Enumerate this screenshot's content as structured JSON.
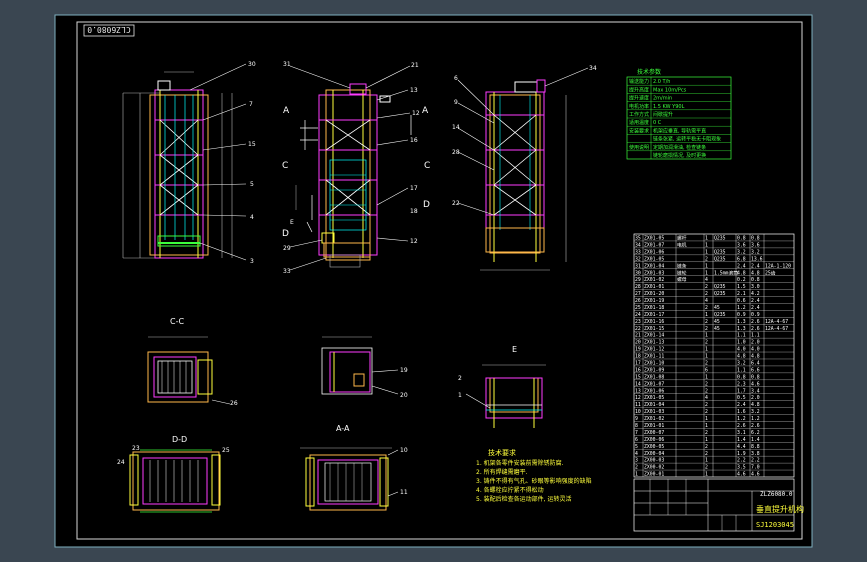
{
  "drawing": {
    "code_box": "CLZ6080.0",
    "view_labels": {
      "cc": "C-C",
      "dd": "D-D",
      "aa": "A-A",
      "detail": "E"
    },
    "section_marks": [
      "A",
      "A",
      "C",
      "C",
      "D",
      "D",
      "E"
    ],
    "callouts": [
      "30",
      "7",
      "15",
      "5",
      "4",
      "3",
      "31",
      "21",
      "13",
      "12",
      "16",
      "17",
      "18",
      "12",
      "29",
      "33",
      "6",
      "9",
      "14",
      "28",
      "22",
      "34",
      "19",
      "20",
      "2",
      "1",
      "26",
      "23",
      "24",
      "25",
      "10",
      "11"
    ],
    "tech_title": "技术要求",
    "tech_notes": [
      "1. 机架各零件安装前需除锈防腐.",
      "2. 所有焊缝需磨平.",
      "3. 铸件不得有气孔、砂眼等影响强度的缺陷",
      "4. 各螺栓应拧紧不得松动",
      "5. 装配后检查各运动部件, 运转灵活"
    ],
    "param_title": "技术参数",
    "params": [
      [
        "输送能力",
        "2.0 T/h"
      ],
      [
        "提升高度",
        "Max 10m/Pcs"
      ],
      [
        "提升速度",
        "2m/min"
      ],
      [
        "电机功率",
        "1.5 KW Y90L"
      ],
      [
        "工作方式",
        "间歇提升"
      ],
      [
        "适用温度",
        "0 C"
      ],
      [
        "安装要求",
        "机架应垂直, 导轨需平直"
      ],
      [
        "",
        "链条张紧, 运转平稳无卡阻现象"
      ],
      [
        "使用说明",
        "定期加润滑油, 检查链条"
      ],
      [
        "",
        "链轮磨损情况, 及时更换"
      ]
    ],
    "bom": [
      [
        "35",
        "ZX01-05",
        "螺杆",
        "1",
        "Q235",
        "0.8",
        "0.8",
        ""
      ],
      [
        "34",
        "ZX01-07",
        "电机",
        "1",
        "",
        "3.6",
        "3.6",
        ""
      ],
      [
        "33",
        "ZX01-06",
        "",
        "1",
        "Q235",
        "3.2",
        "3.2",
        ""
      ],
      [
        "32",
        "ZX01-05",
        "",
        "2",
        "Q235",
        "6.8",
        "13.6",
        ""
      ],
      [
        "31",
        "ZX01-04",
        "链条",
        "1",
        "",
        "2.4",
        "2.4",
        "12A-1-120"
      ],
      [
        "30",
        "ZX01-03",
        "链轮",
        "1",
        "1.5mm滚筒",
        "4.8",
        "4.8",
        "25齿"
      ],
      [
        "29",
        "ZX01-02",
        "螺母",
        "4",
        "",
        "0.2",
        "0.8",
        ""
      ],
      [
        "28",
        "ZX01-01",
        "",
        "2",
        "Q235",
        "1.5",
        "3.0",
        ""
      ],
      [
        "27",
        "ZX01-20",
        "",
        "2",
        "Q235",
        "2.1",
        "4.2",
        ""
      ],
      [
        "26",
        "ZX01-19",
        "",
        "4",
        "",
        "0.6",
        "2.4",
        ""
      ],
      [
        "25",
        "ZX01-18",
        "",
        "2",
        "45",
        "1.2",
        "2.4",
        ""
      ],
      [
        "24",
        "ZX01-17",
        "",
        "1",
        "Q235",
        "0.9",
        "0.9",
        ""
      ],
      [
        "23",
        "ZX01-16",
        "",
        "2",
        "45",
        "1.3",
        "2.6",
        "12A-4-67"
      ],
      [
        "22",
        "ZX01-15",
        "",
        "2",
        "45",
        "1.3",
        "2.6",
        "12A-4-67"
      ],
      [
        "21",
        "ZX01-14",
        "",
        "1",
        "",
        "1.1",
        "1.1",
        ""
      ],
      [
        "20",
        "ZX01-13",
        "",
        "2",
        "",
        "1.0",
        "2.0",
        ""
      ],
      [
        "19",
        "ZX01-12",
        "",
        "1",
        "",
        "4.0",
        "4.0",
        ""
      ],
      [
        "18",
        "ZX01-11",
        "",
        "1",
        "",
        "4.8",
        "4.8",
        ""
      ],
      [
        "17",
        "ZX01-10",
        "",
        "2",
        "",
        "3.2",
        "6.4",
        ""
      ],
      [
        "16",
        "ZX01-09",
        "",
        "6",
        "",
        "1.1",
        "6.6",
        ""
      ],
      [
        "15",
        "ZX01-08",
        "",
        "1",
        "",
        "0.8",
        "0.8",
        ""
      ],
      [
        "14",
        "ZX01-07",
        "",
        "2",
        "",
        "2.3",
        "4.6",
        ""
      ],
      [
        "13",
        "ZX01-06",
        "",
        "2",
        "",
        "1.7",
        "3.4",
        ""
      ],
      [
        "12",
        "ZX01-05",
        "",
        "4",
        "",
        "0.5",
        "2.0",
        ""
      ],
      [
        "11",
        "ZX01-04",
        "",
        "2",
        "",
        "2.4",
        "4.8",
        ""
      ],
      [
        "10",
        "ZX01-03",
        "",
        "2",
        "",
        "1.6",
        "3.2",
        ""
      ],
      [
        "9",
        "ZX01-02",
        "",
        "1",
        "",
        "1.2",
        "1.2",
        ""
      ],
      [
        "8",
        "ZX01-01",
        "",
        "1",
        "",
        "2.6",
        "2.6",
        ""
      ],
      [
        "7",
        "ZX00-07",
        "",
        "2",
        "",
        "3.1",
        "6.2",
        ""
      ],
      [
        "6",
        "ZX00-06",
        "",
        "1",
        "",
        "1.4",
        "1.4",
        ""
      ],
      [
        "5",
        "ZX00-05",
        "",
        "2",
        "",
        "4.4",
        "8.8",
        ""
      ],
      [
        "4",
        "ZX00-04",
        "",
        "2",
        "",
        "1.9",
        "3.8",
        ""
      ],
      [
        "3",
        "ZX00-03",
        "",
        "1",
        "",
        "2.2",
        "2.2",
        ""
      ],
      [
        "2",
        "ZX00-02",
        "",
        "2",
        "",
        "3.5",
        "7.0",
        ""
      ],
      [
        "1",
        "ZX00-01",
        "",
        "1",
        "",
        "4.6",
        "4.6",
        ""
      ]
    ],
    "title_block": {
      "name": "垂直提升机构",
      "code": "ZLZ6080.0",
      "num": "SJ1203045"
    }
  }
}
